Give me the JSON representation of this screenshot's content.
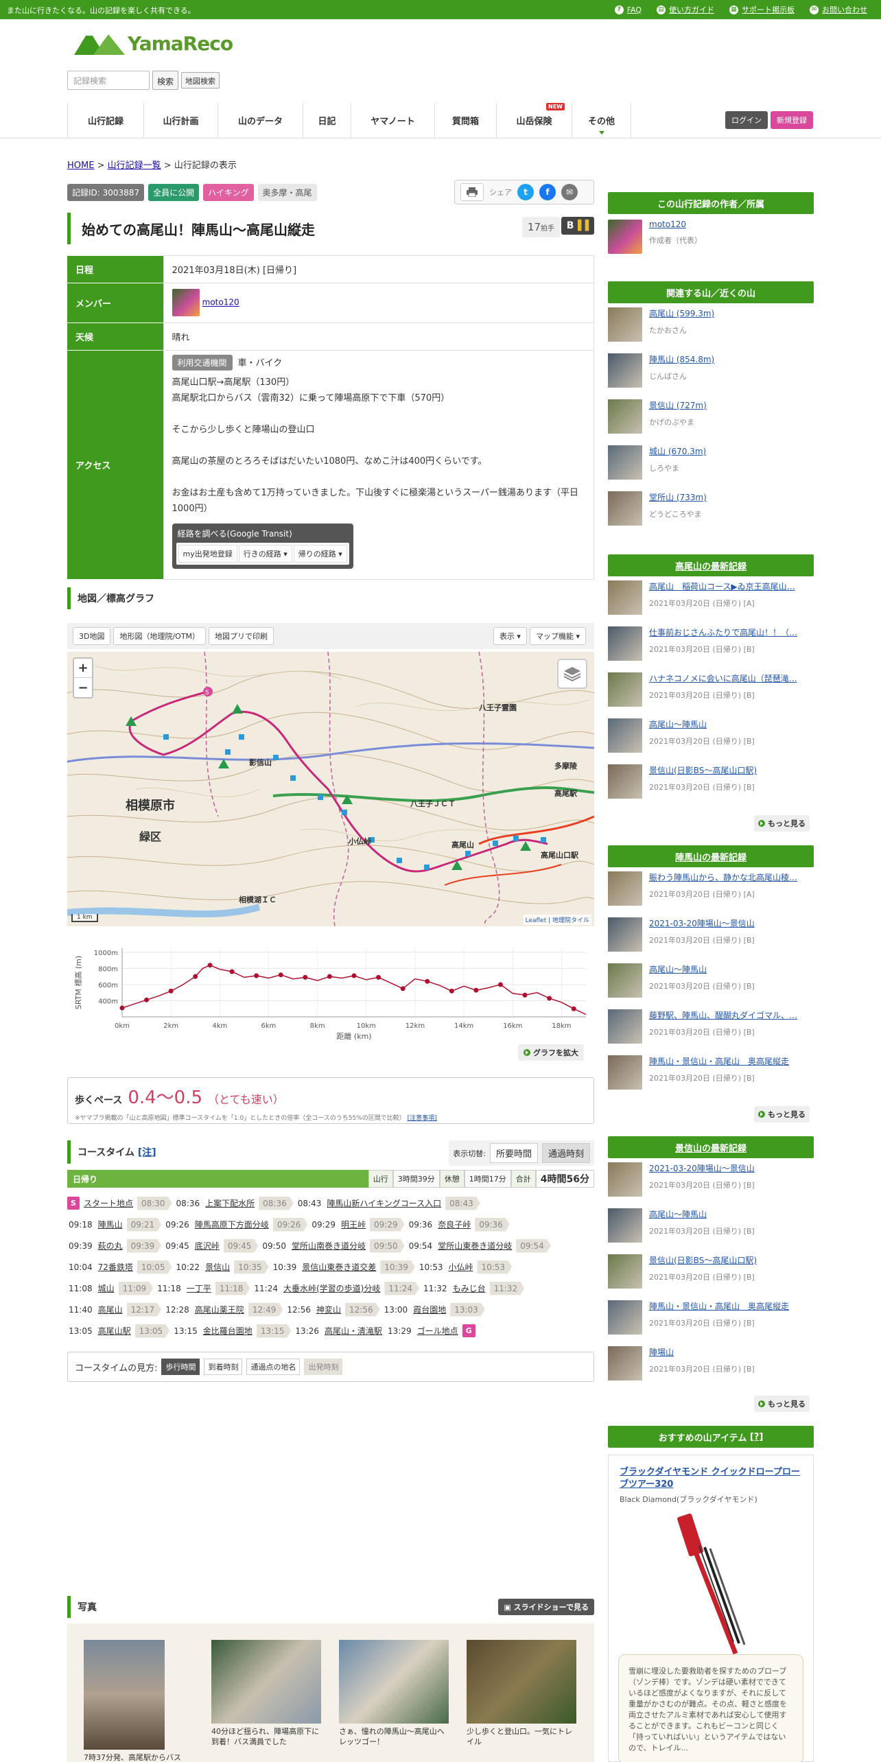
{
  "topbar": {
    "tagline": "また山に行きたくなる。山の記録を楽しく共有できる。",
    "links": [
      "FAQ",
      "使い方ガイド",
      "サポート掲示板",
      "お問い合わせ"
    ]
  },
  "header": {
    "logo_text": "YamaReco",
    "search_placeholder": "記録検索",
    "search_button": "検索",
    "map_search_button": "地図検索",
    "nav": [
      "山行記録",
      "山行計画",
      "山のデータ",
      "日記",
      "ヤマノート",
      "質問箱",
      "山岳保険",
      "その他"
    ],
    "nav_new_badge": "NEW",
    "login": "ログイン",
    "register": "新規登録"
  },
  "breadcrumb": {
    "home": "HOME",
    "sep": ">",
    "list": "山行記録一覧",
    "current": "山行記録の表示"
  },
  "tags": [
    "記録ID: 3003887",
    "全員に公開",
    "ハイキング",
    "奥多摩・高尾"
  ],
  "share": {
    "label": "シェア"
  },
  "record": {
    "title": "始めての高尾山！陣馬山～高尾山縦走",
    "claps": "17",
    "claps_unit": "拍手",
    "b_label": "B"
  },
  "info": {
    "date_label": "日程",
    "date": "2021年03月18日(木) [日帰り]",
    "member_label": "メンバー",
    "member": "moto120",
    "weather_label": "天候",
    "weather": "晴れ",
    "access_label": "アクセス",
    "transport_tag": "利用交通機関",
    "transport": "車・バイク",
    "access_lines": [
      "高尾山口駅→高尾駅（130円）",
      "高尾駅北口からバス（雲南32）に乗って陣場高原下で下車（570円）",
      "",
      "そこから少し歩くと陣場山の登山口",
      "",
      "高尾山の茶屋のとろろそばはだいたい1080円、なめこ汁は400円くらいです。",
      "",
      "お金はお土産も含めて1万持っていきました。下山後すぐに極楽湯というスーパー銭湯あります（平日1000円）"
    ],
    "route_title": "経路を調べる(Google Transit)",
    "route_buttons": [
      "my出発地登録",
      "行きの経路 ▾",
      "帰りの経路 ▾"
    ]
  },
  "map_section": {
    "heading": "地図／標高グラフ",
    "tools": [
      "3D地図",
      "地形図（地理院/OTM）",
      "地図プリで印刷"
    ],
    "right_tools": [
      "表示 ▾",
      "マップ機能 ▾"
    ],
    "labels": [
      "相模原市",
      "緑区",
      "八王子霊園",
      "高尾駅",
      "高尾山口駅",
      "小仏峠",
      "影信山",
      "八王子ＪＣＴ",
      "多摩陵",
      "高尾山",
      "相模湖ＩＣ"
    ],
    "scale": "1 km",
    "attribution": "Leaflet | 地理院タイル"
  },
  "chart_data": {
    "type": "line",
    "ylabel": "SRTM 標高 (m)",
    "xlabel": "距離 (km)",
    "x_ticks": [
      "0km",
      "2km",
      "4km",
      "6km",
      "8km",
      "10km",
      "12km",
      "14km",
      "16km",
      "18km"
    ],
    "y_ticks": [
      "1000m",
      "800m",
      "600m",
      "400m"
    ],
    "ylim": [
      200,
      1050
    ],
    "xlim": [
      0,
      19
    ],
    "series": [
      {
        "x": [
          0.0,
          0.5,
          1.0,
          1.5,
          2.0,
          2.5,
          3.0,
          3.3,
          3.6,
          4.0,
          4.5,
          5.0,
          5.5,
          6.0,
          6.5,
          7.0,
          7.5,
          8.0,
          8.5,
          9.0,
          9.5,
          10.0,
          10.5,
          11.0,
          11.5,
          12.0,
          12.5,
          13.0,
          13.5,
          14.0,
          14.5,
          15.0,
          15.5,
          16.0,
          16.5,
          17.0,
          17.5,
          18.0,
          18.5,
          19.0
        ],
        "y": [
          310,
          360,
          410,
          460,
          520,
          600,
          700,
          800,
          840,
          790,
          760,
          690,
          710,
          680,
          720,
          670,
          690,
          650,
          700,
          680,
          710,
          660,
          690,
          620,
          550,
          670,
          640,
          590,
          520,
          580,
          530,
          560,
          600,
          490,
          470,
          500,
          430,
          380,
          300,
          230
        ]
      }
    ]
  },
  "zoom_graph": "グラフを拡大",
  "pace": {
    "label": "歩くペース",
    "value": "0.4～0.5",
    "desc": "（とても速い）",
    "note": "※ヤマプラ掲載の「山と高原地図」標準コースタイムを「1.0」としたときの倍率（全コースのうち55%の区間で比較）",
    "note_link": "[注意事項]"
  },
  "coursetime": {
    "heading": "コースタイム",
    "heading_link": "[注]",
    "switch_label": "表示切替:",
    "switch_options": [
      "所要時間",
      "通過時刻"
    ],
    "day": "日帰り",
    "cells": [
      "山行",
      "3時間39分",
      "休憩",
      "1時間17分",
      "合計",
      "4時間56分"
    ],
    "rows": [
      [
        [
          "S",
          "スタート地点",
          "08:30"
        ],
        [
          "08:36",
          "上案下配水所",
          "08:36"
        ],
        [
          "08:43",
          "陣馬山新ハイキングコース入口",
          "08:43"
        ]
      ],
      [
        [
          "09:18",
          "陣馬山",
          "09:21"
        ],
        [
          "09:26",
          "陣馬高原下方面分岐",
          "09:26"
        ],
        [
          "09:29",
          "明王峠",
          "09:29"
        ],
        [
          "09:36",
          "奈良子峠",
          "09:36"
        ]
      ],
      [
        [
          "09:39",
          "萩の丸",
          "09:39"
        ],
        [
          "09:45",
          "底沢峠",
          "09:45"
        ],
        [
          "09:50",
          "堂所山南巻き道分岐",
          "09:50"
        ],
        [
          "09:54",
          "堂所山東巻き道分岐",
          "09:54"
        ]
      ],
      [
        [
          "10:04",
          "72番鉄塔",
          "10:05"
        ],
        [
          "10:22",
          "景信山",
          "10:35"
        ],
        [
          "10:39",
          "景信山東巻き道交差",
          "10:39"
        ],
        [
          "10:53",
          "小仏峠",
          "10:53"
        ]
      ],
      [
        [
          "11:08",
          "城山",
          "11:09"
        ],
        [
          "11:18",
          "一丁平",
          "11:18"
        ],
        [
          "11:24",
          "大垂水峠(学習の歩道)分岐",
          "11:24"
        ],
        [
          "11:32",
          "もみじ台",
          "11:32"
        ]
      ],
      [
        [
          "11:40",
          "高尾山",
          "12:17"
        ],
        [
          "12:28",
          "高尾山薬王院",
          "12:49"
        ],
        [
          "12:56",
          "神変山",
          "12:56"
        ],
        [
          "13:00",
          "霞台園地",
          "13:03"
        ]
      ],
      [
        [
          "13:05",
          "高尾山駅",
          "13:05"
        ],
        [
          "13:15",
          "金比羅台園地",
          "13:15"
        ],
        [
          "13:26",
          "高尾山・清滝駅",
          ""
        ],
        [
          "13:29",
          "ゴール地点",
          "G"
        ]
      ]
    ],
    "legend_label": "コースタイムの見方:",
    "legend": [
      "歩行時間",
      "到着時刻",
      "通過点の地名",
      "出発時刻"
    ]
  },
  "photos": {
    "heading": "写真",
    "slideshow": "スライドショーで見る",
    "captions": [
      "7時37分発、高尾駅からバス",
      "40分ほど揺られ、陣場高原下に到着！バス満員でした",
      "さぁ、憧れの陣馬山～高尾山へレッツゴー！",
      "少し歩くと登山口。一気にトレイル"
    ]
  },
  "sidebar": {
    "author_h": "この山行記録の作者／所属",
    "author_name": "moto120",
    "author_role": "作成者（代表）",
    "related_h": "関連する山／近くの山",
    "related": [
      {
        "name": "高尾山 (599.3m)",
        "reading": "たかおさん"
      },
      {
        "name": "陣馬山 (854.8m)",
        "reading": "じんばさん"
      },
      {
        "name": "景信山 (727m)",
        "reading": "かげのぶやま"
      },
      {
        "name": "城山 (670.3m)",
        "reading": "しろやま"
      },
      {
        "name": "堂所山 (733m)",
        "reading": "どうどころやま"
      }
    ],
    "takao_h": "高尾山の最新記録",
    "takao": [
      {
        "t": "高尾山　稲荷山コース▶ゐ京王高尾山…",
        "d": "2021年03月20日 (日帰り) [A]"
      },
      {
        "t": "仕事前おじさんふたりで高尾山！！（…",
        "d": "2021年03月20日 (日帰り) [B]"
      },
      {
        "t": "ハナネコノメに会いに高尾山（琵琶滝…",
        "d": "2021年03月20日 (日帰り) [B]"
      },
      {
        "t": "高尾山～陣馬山",
        "d": "2021年03月20日 (日帰り) [B]"
      },
      {
        "t": "景信山(日影BS～高尾山口駅)",
        "d": "2021年03月20日 (日帰り) [B]"
      }
    ],
    "jinba_h": "陣馬山の最新記録",
    "jinba": [
      {
        "t": "賑わう陣馬山から、静かな北高尾山稜…",
        "d": "2021年03月20日 (日帰り) [A]"
      },
      {
        "t": "2021-03-20陣場山～景信山",
        "d": "2021年03月20日 (日帰り) [B]"
      },
      {
        "t": "高尾山～陣馬山",
        "d": "2021年03月20日 (日帰り) [B]"
      },
      {
        "t": "藤野駅、陣馬山、醍醐丸ダイゴマル、…",
        "d": "2021年03月20日 (日帰り) [B]"
      },
      {
        "t": "陣馬山・景信山・高尾山　奥高尾縦走",
        "d": "2021年03月20日 (日帰り) [B]"
      }
    ],
    "kage_h": "景信山の最新記録",
    "kage": [
      {
        "t": "2021-03-20陣場山～景信山",
        "d": "2021年03月20日 (日帰り) [B]"
      },
      {
        "t": "高尾山～陣馬山",
        "d": "2021年03月20日 (日帰り) [B]"
      },
      {
        "t": "景信山(日影BS～高尾山口駅)",
        "d": "2021年03月20日 (日帰り) [B]"
      },
      {
        "t": "陣馬山・景信山・高尾山　奥高尾縦走",
        "d": "2021年03月20日 (日帰り) [B]"
      },
      {
        "t": "陣場山",
        "d": "2021年03月20日 (日帰り) [B]"
      }
    ],
    "more": "もっと見る",
    "item_h": "おすすめの山アイテム",
    "item_h_link": "[?]",
    "item_name": "ブラックダイヤモンド クイックドロープローブツアー320",
    "item_brand": "Black Diamond(ブラックダイヤモンド)",
    "item_desc": "雪崩に埋没した要救助者を探すためのプローブ（ゾンデ棒）です。ゾンデは硬い素材でできているほど感度がよくなりますが、それに反して重量がかさむのが難点。その点、軽さと感度を両立させたアルミ素材であれば安心して使用することができます。これもビーコンと同じく「持っていればいい」というアイテムではないので、トレイル..."
  }
}
